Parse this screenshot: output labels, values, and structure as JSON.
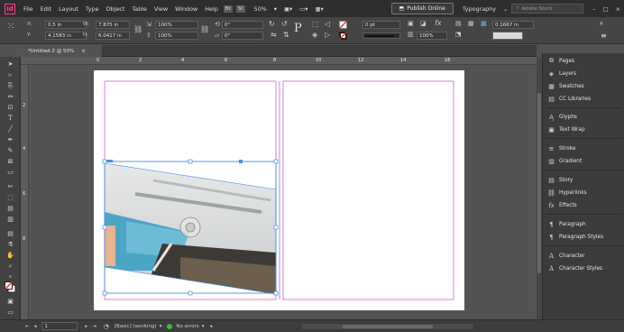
{
  "app": {
    "logo": "Id"
  },
  "menu": [
    "File",
    "Edit",
    "Layout",
    "Type",
    "Object",
    "Table",
    "View",
    "Window",
    "Help"
  ],
  "menubar": {
    "br_chip": "Br",
    "st_chip": "St",
    "zoom": "50%",
    "publish": "Publish Online",
    "workspace": "Typography",
    "search_placeholder": "Adobe Stock"
  },
  "control": {
    "x_label": "X:",
    "x_value": "0.5 in",
    "y_label": "Y:",
    "y_value": "4.1583 in",
    "w_label": "W:",
    "w_value": "7.875 in",
    "h_label": "H:",
    "h_value": "6.0417 in",
    "scale_x": "100%",
    "scale_y": "100%",
    "rotate": "0°",
    "shear": "0°",
    "stroke_weight": "0 pt",
    "opacity": "100%",
    "offset": "0.1667 in"
  },
  "document": {
    "tab_title": "*Untitled-2 @ 50%",
    "close": "×"
  },
  "ruler": {
    "h_ticks": [
      "0",
      "2",
      "4",
      "6",
      "8",
      "10",
      "12",
      "14",
      "16"
    ],
    "v_ticks": [
      "2",
      "4",
      "6",
      "8"
    ]
  },
  "panels": [
    {
      "name": "Pages",
      "icon": "pages-icon"
    },
    {
      "name": "Layers",
      "icon": "layers-icon"
    },
    {
      "name": "Swatches",
      "icon": "swatches-icon"
    },
    {
      "name": "CC Libraries",
      "icon": "cc-libraries-icon"
    },
    {
      "name": "Glyphs",
      "icon": "glyphs-icon"
    },
    {
      "name": "Text Wrap",
      "icon": "text-wrap-icon"
    },
    {
      "name": "Stroke",
      "icon": "stroke-icon"
    },
    {
      "name": "Gradient",
      "icon": "gradient-icon"
    },
    {
      "name": "Story",
      "icon": "story-icon"
    },
    {
      "name": "Hyperlinks",
      "icon": "hyperlinks-icon"
    },
    {
      "name": "Effects",
      "icon": "effects-icon"
    },
    {
      "name": "Paragraph",
      "icon": "paragraph-icon"
    },
    {
      "name": "Paragraph Styles",
      "icon": "paragraph-styles-icon"
    },
    {
      "name": "Character",
      "icon": "character-icon"
    },
    {
      "name": "Character Styles",
      "icon": "character-styles-icon"
    }
  ],
  "status": {
    "page": "1",
    "style": "[Basic] (working)",
    "errors": "No errors"
  },
  "colors": {
    "accent_magenta": "#d65fd0",
    "selection_blue": "#4d8ce8",
    "menubar": "#2e2e2e",
    "pasteboard": "#535353",
    "preflight_ok": "#3fbf3f"
  }
}
